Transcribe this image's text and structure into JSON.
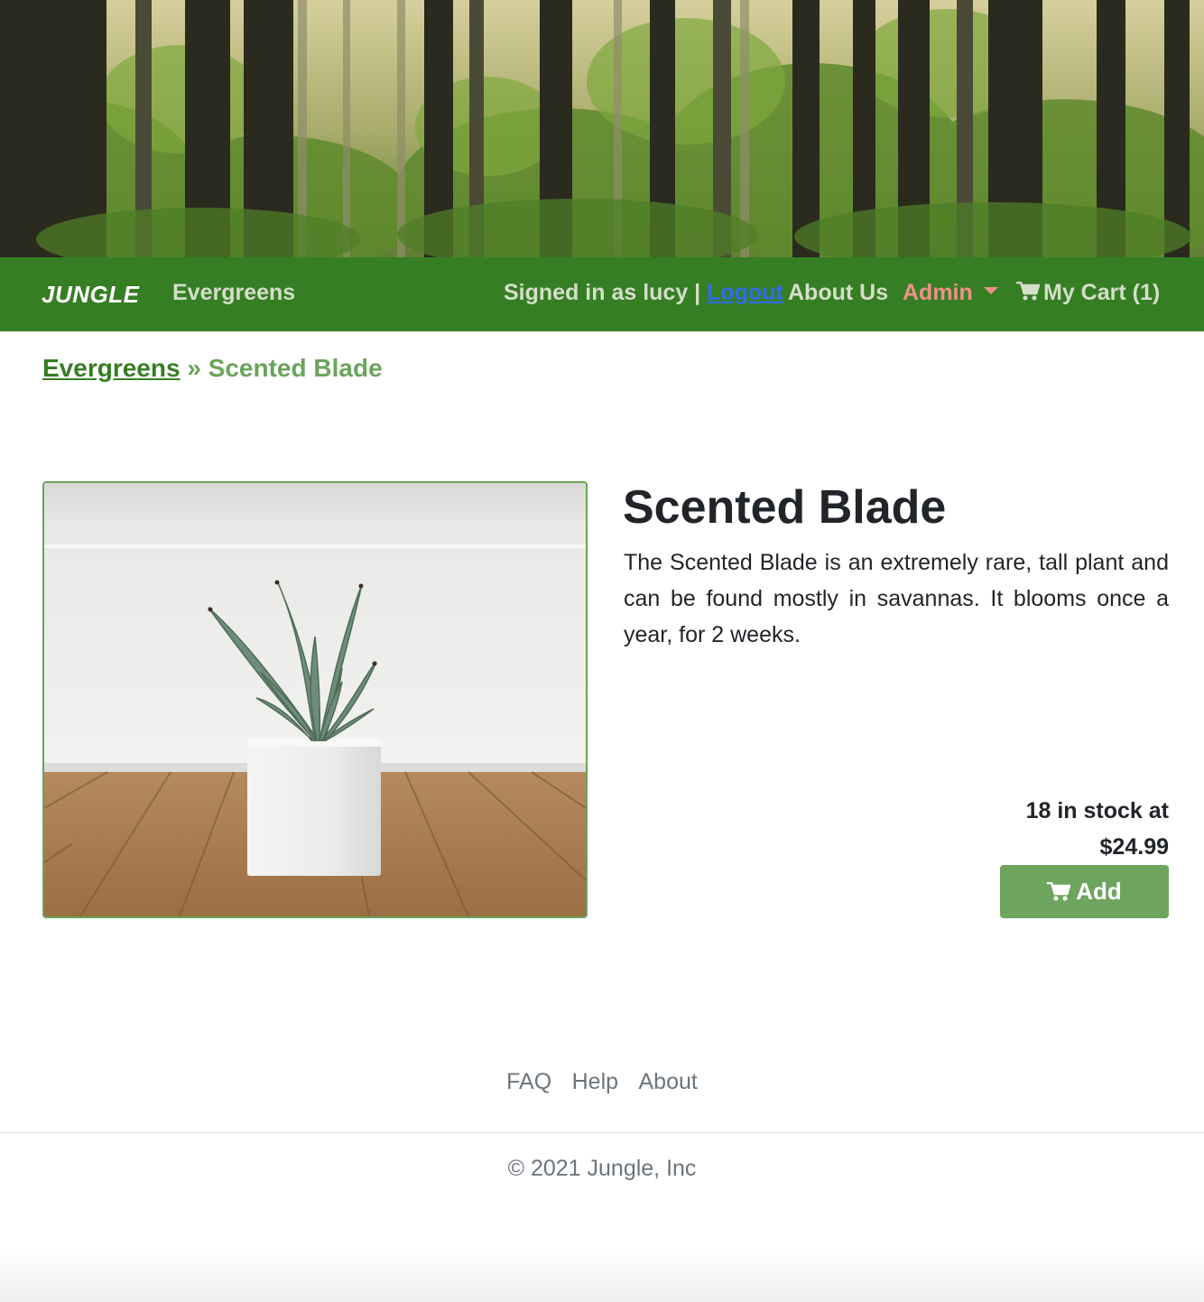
{
  "colors": {
    "navbar_bg": "#367e23",
    "nav_text": "#d4dec9",
    "logout_link": "#2f6cf0",
    "admin_link": "#f0908c",
    "breadcrumb_link": "#367e23",
    "breadcrumb_current": "#6aa45b",
    "add_button_bg": "#6ea55e",
    "footer_text": "#6c757d"
  },
  "hero": {
    "icon": "forest-banner"
  },
  "navbar": {
    "brand": "JUNGLE",
    "category_link": "Evergreens",
    "signed_in_text": "Signed in as lucy |",
    "logout_label": "Logout",
    "about_label": "About Us",
    "admin_label": "Admin",
    "cart_label": "My Cart (1)",
    "cart_icon": "shopping-cart-icon"
  },
  "breadcrumb": {
    "parent": "Evergreens",
    "separator": "»",
    "current": "Scented Blade"
  },
  "product": {
    "name": "Scented Blade",
    "description": "The Scented Blade is an extremely rare, tall plant and can be found mostly in savannas. It blooms once a year, for 2 weeks.",
    "stock_text": "18 in stock at",
    "price": "$24.99",
    "add_label": "Add",
    "image_icon": "potted-succulent-photo"
  },
  "footer": {
    "links": [
      "FAQ",
      "Help",
      "About"
    ],
    "copyright": "© 2021 Jungle, Inc"
  }
}
